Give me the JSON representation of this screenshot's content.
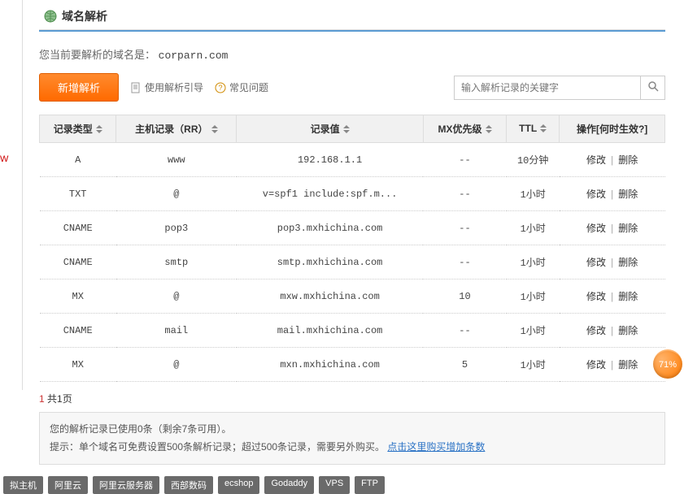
{
  "leftMarker": "W",
  "panel": {
    "title": "域名解析",
    "subtitle_prefix": "您当前要解析的域名是：",
    "domain": "corparn.com"
  },
  "actions": {
    "new_record": "新增解析",
    "guide": "使用解析引导",
    "faq": "常见问题"
  },
  "search": {
    "placeholder": "输入解析记录的关键字"
  },
  "table": {
    "headers": {
      "type": "记录类型",
      "host": "主机记录（RR）",
      "value": "记录值",
      "mx": "MX优先级",
      "ttl": "TTL",
      "ops": "操作[何时生效?]"
    },
    "rows": [
      {
        "type": "A",
        "host": "www",
        "value": "192.168.1.1",
        "mx": "--",
        "ttl": "10分钟"
      },
      {
        "type": "TXT",
        "host": "@",
        "value": "v=spf1 include:spf.m...",
        "mx": "--",
        "ttl": "1小时"
      },
      {
        "type": "CNAME",
        "host": "pop3",
        "value": "pop3.mxhichina.com",
        "mx": "--",
        "ttl": "1小时"
      },
      {
        "type": "CNAME",
        "host": "smtp",
        "value": "smtp.mxhichina.com",
        "mx": "--",
        "ttl": "1小时"
      },
      {
        "type": "MX",
        "host": "@",
        "value": "mxw.mxhichina.com",
        "mx": "10",
        "ttl": "1小时"
      },
      {
        "type": "CNAME",
        "host": "mail",
        "value": "mail.mxhichina.com",
        "mx": "--",
        "ttl": "1小时"
      },
      {
        "type": "MX",
        "host": "@",
        "value": "mxn.mxhichina.com",
        "mx": "5",
        "ttl": "1小时"
      }
    ],
    "op_edit": "修改",
    "op_delete": "删除"
  },
  "pager": {
    "text": "共1页",
    "num": "1"
  },
  "tips": {
    "line1": "您的解析记录已使用0条（剩余7条可用）。",
    "line2_a": "提示：单个域名可免费设置500条解析记录；超过500条记录，需要另外购买。",
    "buy_link": "点击这里购买增加条数"
  },
  "tags": [
    "拟主机",
    "阿里云",
    "阿里云服务器",
    "西部数码",
    "ecshop",
    "Godaddy",
    "VPS",
    "FTP"
  ],
  "gauge": "71%"
}
